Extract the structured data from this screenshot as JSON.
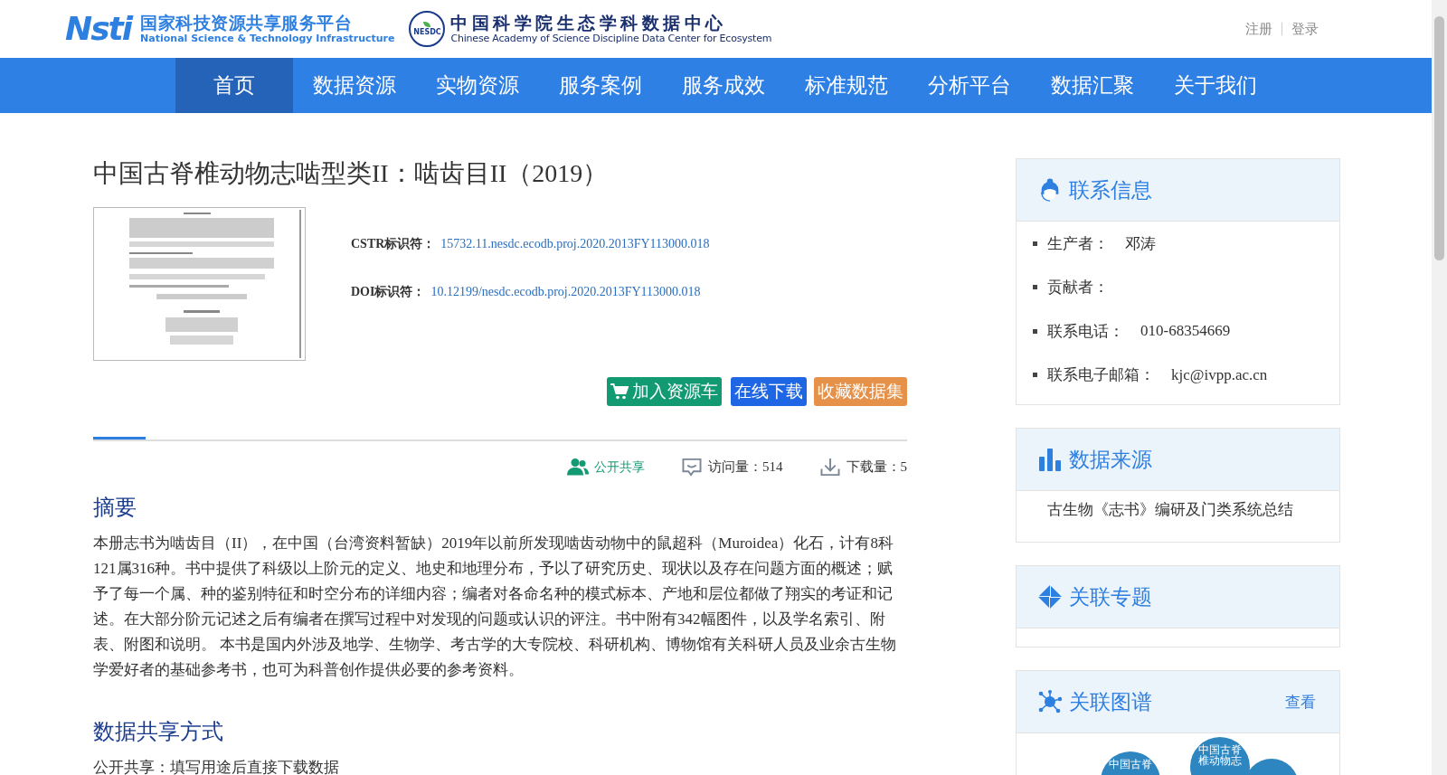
{
  "header": {
    "logo_mark": "Nsti",
    "platform_name": "国家科技资源共享服务平台",
    "platform_name_en": "National Science & Technology Infrastructure",
    "badge_text": "NESDC",
    "center_name": "中国科学院生态学科数据中心",
    "center_name_en": "Chinese Academy of Science Discipline Data Center for Ecosystem",
    "links": [
      "注册",
      "登录"
    ]
  },
  "nav": [
    {
      "label": "首页",
      "selected": true
    },
    {
      "label": "数据资源",
      "selected": false
    },
    {
      "label": "实物资源",
      "selected": false
    },
    {
      "label": "服务案例",
      "selected": false
    },
    {
      "label": "服务成效",
      "selected": false
    },
    {
      "label": "标准规范",
      "selected": false
    },
    {
      "label": "分析平台",
      "selected": false
    },
    {
      "label": "数据汇聚",
      "selected": false
    },
    {
      "label": "关于我们",
      "selected": false
    }
  ],
  "dataset": {
    "title": "中国古脊椎动物志啮型类II：啮齿目II（2019）",
    "identifiers": [
      {
        "label": "CSTR标识符：",
        "value": "15732.11.nesdc.ecodb.proj.2020.2013FY113000.018"
      },
      {
        "label": "DOI标识符：",
        "value": "10.12199/nesdc.ecodb.proj.2020.2013FY113000.018"
      }
    ],
    "buttons": [
      {
        "kind": "cart",
        "label": "加入资源车"
      },
      {
        "kind": "download",
        "label": "在线下载"
      },
      {
        "kind": "favorite",
        "label": "收藏数据集"
      }
    ],
    "stats": [
      {
        "kind": "share",
        "text": "公开共享"
      },
      {
        "kind": "visits",
        "text": "访问量：514"
      },
      {
        "kind": "downloads",
        "text": "下载量：5"
      }
    ]
  },
  "sections": [
    {
      "heading": "摘要",
      "text": "本册志书为啮齿目（II），在中国（台湾资料暂缺）2019年以前所发现啮齿动物中的鼠超科（Muroidea）化石，计有8科121属316种。书中提供了科级以上阶元的定义、地史和地理分布，予以了研究历史、现状以及存在问题方面的概述；赋予了每一个属、种的鉴别特征和时空分布的详细内容；编者对各命名种的模式标本、产地和层位都做了翔实的考证和记述。在大部分阶元记述之后有编者在撰写过程中对发现的问题或认识的评注。书中附有342幅图件，以及学名索引、附表、附图和说明。 本书是国内外涉及地学、生物学、考古学的大专院校、科研机构、博物馆有关科研人员及业余古生物学爱好者的基础参考书，也可为科普创作提供必要的参考资料。"
    },
    {
      "heading": "数据共享方式",
      "text": "公开共享：填写用途后直接下载数据"
    }
  ],
  "sidebar": [
    {
      "kind": "contact",
      "title": "联系信息",
      "items": [
        {
          "label": "生产者：",
          "value": "邓涛"
        },
        {
          "label": "贡献者："
        },
        {
          "label": "联系电话：",
          "value": "010-68354669"
        },
        {
          "label": "联系电子邮箱：",
          "value": "kjc@ivpp.ac.cn"
        }
      ]
    },
    {
      "kind": "source",
      "title": "数据来源",
      "text": "古生物《志书》编研及门类系统总结"
    },
    {
      "kind": "topics",
      "title": "关联专题"
    },
    {
      "kind": "graph",
      "title": "关联图谱",
      "link": "查看",
      "nodes": [
        "中国古脊",
        "中国古脊椎动物志"
      ]
    }
  ]
}
